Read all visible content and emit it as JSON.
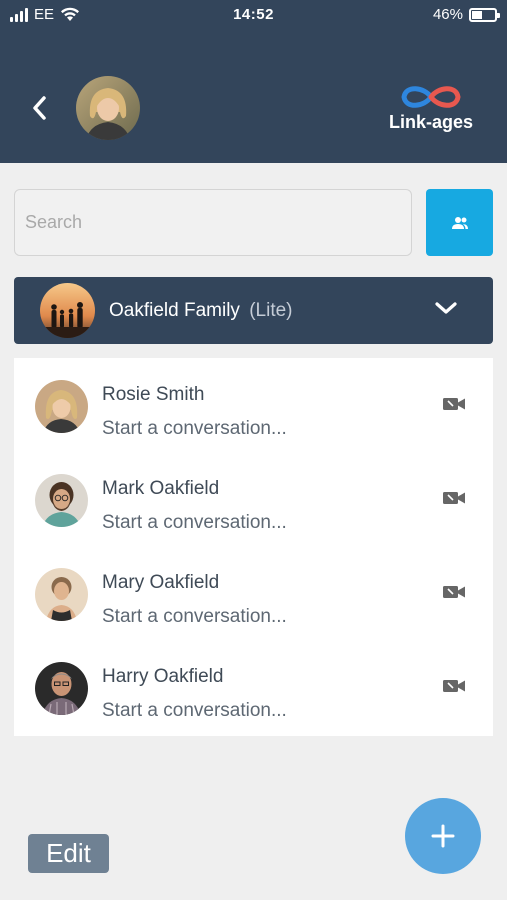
{
  "status_bar": {
    "carrier": "EE",
    "time": "14:52",
    "battery_percent": "46%",
    "battery_level": 0.46
  },
  "header": {
    "back_icon": "chevron-left-icon",
    "logo_text": "Link-ages",
    "logo_colors": [
      "#2e86de",
      "#e8584f"
    ]
  },
  "search": {
    "placeholder": "Search",
    "value": ""
  },
  "group": {
    "name": "Oakfield Family",
    "tier": "(Lite)"
  },
  "contacts": [
    {
      "name": "Rosie Smith",
      "subtitle": "Start a conversation..."
    },
    {
      "name": "Mark Oakfield",
      "subtitle": "Start a conversation..."
    },
    {
      "name": "Mary Oakfield",
      "subtitle": "Start a conversation..."
    },
    {
      "name": "Harry Oakfield",
      "subtitle": "Start a conversation..."
    }
  ],
  "footer": {
    "edit_label": "Edit",
    "fab_icon": "plus-icon"
  },
  "colors": {
    "header_bg": "#33455b",
    "accent_blue": "#17a9e1",
    "fab_blue": "#58a6df",
    "edit_bg": "#6f8193"
  }
}
